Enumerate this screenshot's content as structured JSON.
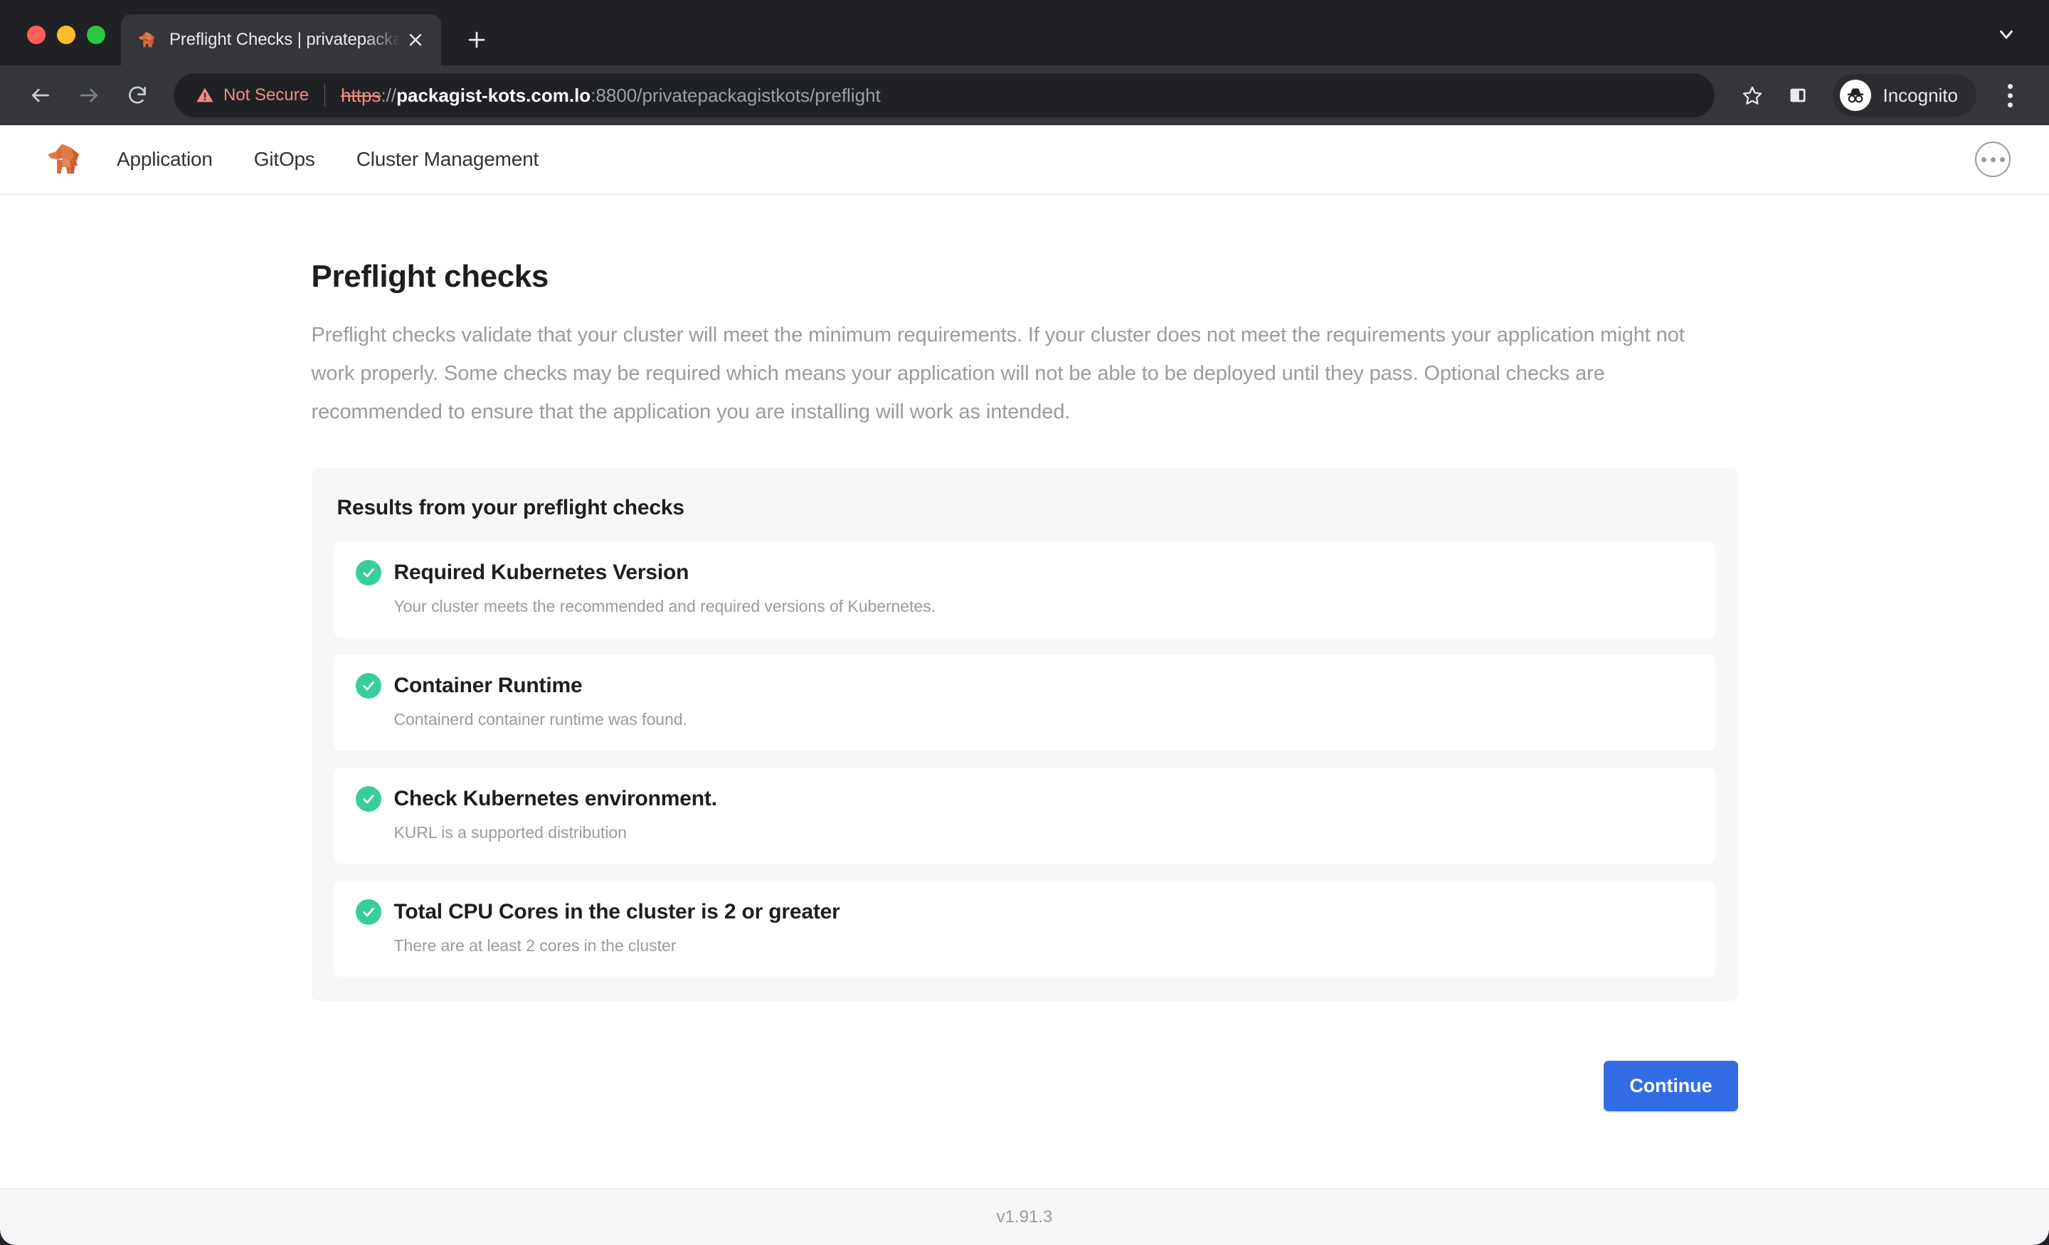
{
  "browser": {
    "tab": {
      "title": "Preflight Checks | privatepacka",
      "favicon_icon": "elephant-logo-icon",
      "close_icon": "close-icon",
      "new_tab_icon": "plus-icon",
      "tab_list_chevron_icon": "chevron-down-icon"
    },
    "toolbar": {
      "back_icon": "arrow-left-icon",
      "forward_icon": "arrow-right-icon",
      "reload_icon": "reload-icon",
      "warning_icon": "warning-triangle-icon",
      "security_label": "Not Secure",
      "url_scheme": "https",
      "url_slashes": "://",
      "url_host": "packagist-kots.com.lo",
      "url_rest": ":8800/privatepackagistkots/preflight",
      "bookmark_icon": "star-icon",
      "side_panel_icon": "side-panel-icon",
      "incognito_icon": "incognito-icon",
      "incognito_label": "Incognito",
      "menu_icon": "kebab-menu-icon"
    }
  },
  "appnav": {
    "logo_icon": "packagist-elephant-logo-icon",
    "links": [
      {
        "label": "Application"
      },
      {
        "label": "GitOps"
      },
      {
        "label": "Cluster Management"
      }
    ],
    "more_icon": "more-options-icon"
  },
  "page": {
    "title": "Preflight checks",
    "description": "Preflight checks validate that your cluster will meet the minimum requirements. If your cluster does not meet the requirements your application might not work properly. Some checks may be required which means your application will not be able to be deployed until they pass. Optional checks are recommended to ensure that the application you are installing will work as intended.",
    "results": {
      "heading": "Results from your preflight checks",
      "checks": [
        {
          "status": "pass",
          "status_icon": "check-circle-icon",
          "name": "Required Kubernetes Version",
          "description": "Your cluster meets the recommended and required versions of Kubernetes."
        },
        {
          "status": "pass",
          "status_icon": "check-circle-icon",
          "name": "Container Runtime",
          "description": "Containerd container runtime was found."
        },
        {
          "status": "pass",
          "status_icon": "check-circle-icon",
          "name": "Check Kubernetes environment.",
          "description": "KURL is a supported distribution"
        },
        {
          "status": "pass",
          "status_icon": "check-circle-icon",
          "name": "Total CPU Cores in the cluster is 2 or greater",
          "description": "There are at least 2 cores in the cluster"
        }
      ]
    },
    "continue_label": "Continue",
    "version": "v1.91.3"
  },
  "colors": {
    "accent_blue": "#326DE6",
    "status_pass_green": "#38CE9C",
    "brand_orange": "#D96A3C",
    "card_bg": "#F5F7F9",
    "muted_text": "#9B9B9B",
    "insecure_red": "#F28B82"
  }
}
